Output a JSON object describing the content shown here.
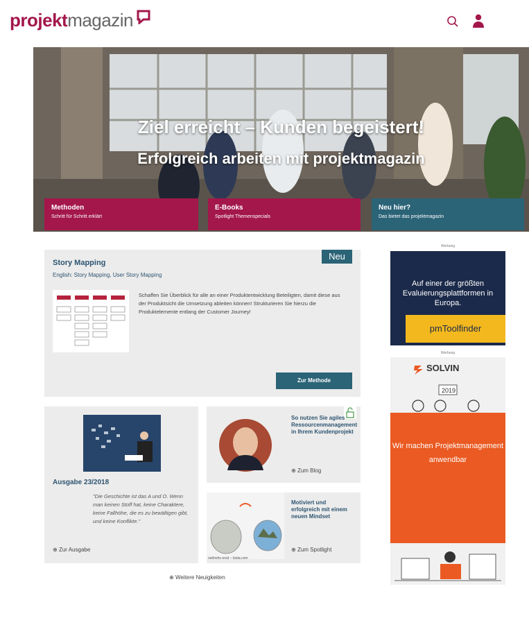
{
  "header": {
    "logo_bold": "projekt",
    "logo_light": "magazin",
    "search_icon": "search-icon",
    "user_icon": "user-icon"
  },
  "hero": {
    "title": "Ziel erreicht – Kunden begeistert!",
    "subtitle": "Erfolgreich arbeiten mit projektmagazin"
  },
  "tiles": [
    {
      "title": "Methoden",
      "sub": "Schritt für Schritt erklärt",
      "color": "#a3174b"
    },
    {
      "title": "E-Books",
      "sub": "Spotlight Themenspecials",
      "color": "#a3174b"
    },
    {
      "title": "Neu hier?",
      "sub": "Das bietet das projektmagazin",
      "color": "#2b6377"
    }
  ],
  "story": {
    "badge": "Neu",
    "title": "Story Mapping",
    "english": "English: Story Mapping, User Story Mapping",
    "text": "Schaffen Sie Überblick für alle an einer Produktentwicklung Beteiligten, damit diese aus der Produktsicht die Umsetzung ableiten können! Strukturieren Sie hierzu die Produktelemente entlang der Customer Journey!",
    "button": "Zur Methode"
  },
  "issue": {
    "title": "Ausgabe 23/2018",
    "quote": "\"Die Geschichte ist das A und O. Wenn man keinen Stoff hat, keine Charaktere, keine Fallhöhe, die es zu bewältigen gibt, und keine Konflikte.\"",
    "link": "Zur Ausgabe"
  },
  "blog": {
    "title": "So nutzen Sie agiles Ressourcenmanagement in Ihrem Kundenprojekt",
    "link": "Zum Blog"
  },
  "spotlight": {
    "title": "Motiviert und erfolgreich mit einem neuen Mindset",
    "link": "Zum Spotlight",
    "caption": "oekhehs-orsd – biota.com"
  },
  "ads": {
    "label": "Werbung",
    "ad1_text": "Auf einer der größten Evaluierungsplattformen in Europa.",
    "ad1_brand": "pmToolfinder",
    "ad2_brand": "SOLVIN",
    "ad2_text": "Wir machen Projektmanagement anwendbar",
    "ad2_year": "2019"
  },
  "more_news": "Weitere Neuigkeiten",
  "colors": {
    "brand": "#a3174b",
    "teal": "#2b6377",
    "navy": "#1b2a4a",
    "orange": "#ea5a22",
    "yellow": "#f2b81d"
  }
}
